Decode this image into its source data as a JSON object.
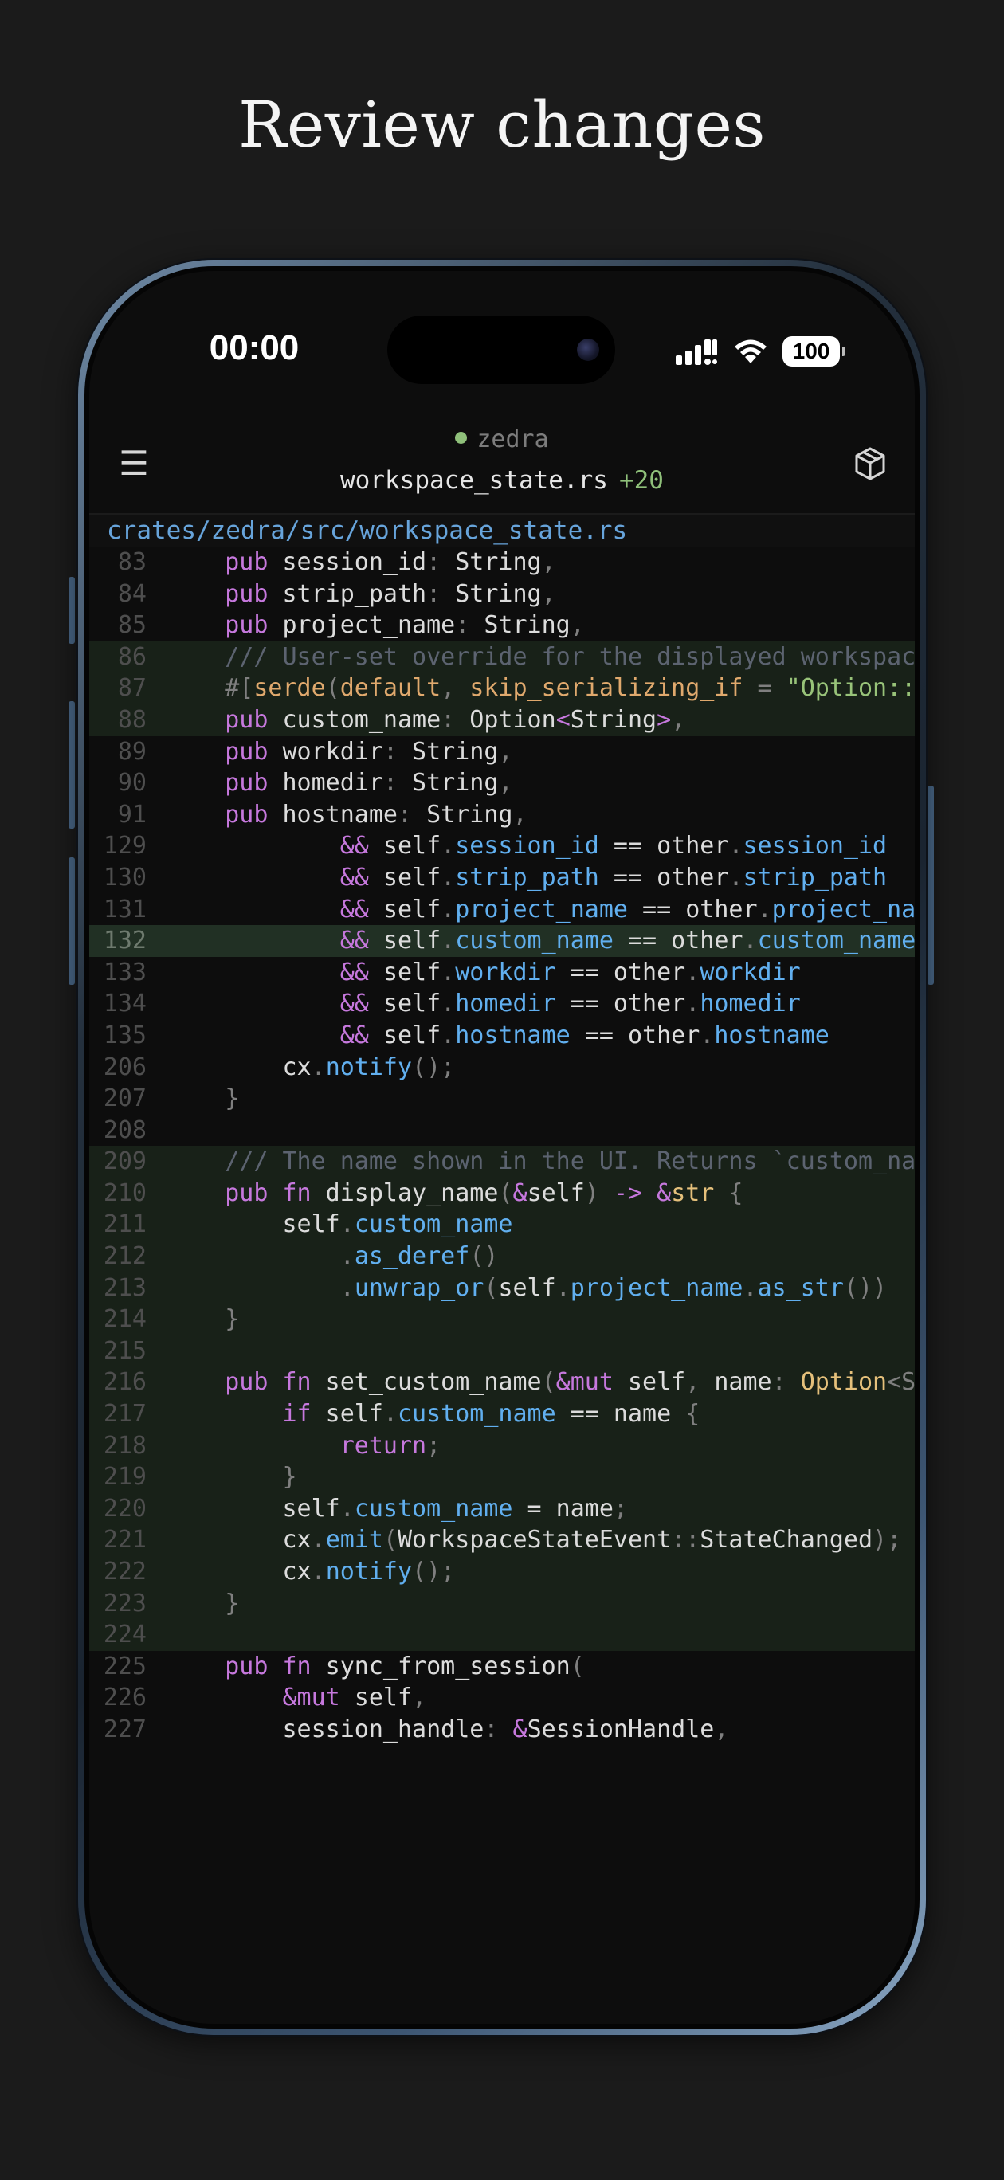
{
  "headline": "Review changes",
  "status_bar": {
    "time": "00:00",
    "battery": "100"
  },
  "nav": {
    "workspace": "zedra",
    "file": "workspace_state.rs",
    "added": "+20"
  },
  "file_path": "crates/zedra/src/workspace_state.rs",
  "colors": {
    "background": "#1b1b1b",
    "screen": "#0d0d0d",
    "added_row": "#182118",
    "keyword": "#c678dd",
    "type": "#e5c07b",
    "string": "#98c379",
    "field": "#61afef",
    "comment": "#5c6370",
    "path": "#67a4db"
  },
  "code_lines": [
    {
      "n": "83",
      "s": "added0",
      "tokens": [
        [
          "    ",
          ""
        ],
        [
          "pub",
          "k"
        ],
        [
          " session_id",
          ""
        ],
        [
          ":",
          "p"
        ],
        [
          " String",
          ""
        ],
        [
          ",",
          "p"
        ]
      ]
    },
    {
      "n": "84",
      "s": "",
      "tokens": [
        [
          "    ",
          ""
        ],
        [
          "pub",
          "k"
        ],
        [
          " strip_path",
          ""
        ],
        [
          ":",
          "p"
        ],
        [
          " String",
          ""
        ],
        [
          ",",
          "p"
        ]
      ]
    },
    {
      "n": "85",
      "s": "",
      "tokens": [
        [
          "    ",
          ""
        ],
        [
          "pub",
          "k"
        ],
        [
          " project_name",
          ""
        ],
        [
          ":",
          "p"
        ],
        [
          " String",
          ""
        ],
        [
          ",",
          "p"
        ]
      ]
    },
    {
      "n": "86",
      "s": "added",
      "tokens": [
        [
          "    ",
          ""
        ],
        [
          "/// User-set override for the displayed workspace name",
          "c"
        ]
      ]
    },
    {
      "n": "87",
      "s": "added",
      "tokens": [
        [
          "    ",
          ""
        ],
        [
          "#[",
          "p"
        ],
        [
          "serde",
          "a"
        ],
        [
          "(",
          "p"
        ],
        [
          "default",
          "a"
        ],
        [
          ", ",
          "p"
        ],
        [
          "skip_serializing_if",
          "a"
        ],
        [
          " = ",
          "p"
        ],
        [
          "\"Option::is_none\"",
          "s"
        ],
        [
          ")]",
          "p"
        ]
      ]
    },
    {
      "n": "88",
      "s": "added",
      "tokens": [
        [
          "    ",
          ""
        ],
        [
          "pub",
          "k"
        ],
        [
          " custom_name",
          ""
        ],
        [
          ":",
          "p"
        ],
        [
          " Option",
          ""
        ],
        [
          "<",
          "k"
        ],
        [
          "String",
          ""
        ],
        [
          ">",
          "k"
        ],
        [
          ",",
          "p"
        ]
      ]
    },
    {
      "n": "89",
      "s": "",
      "tokens": [
        [
          "    ",
          ""
        ],
        [
          "pub",
          "k"
        ],
        [
          " workdir",
          ""
        ],
        [
          ":",
          "p"
        ],
        [
          " String",
          ""
        ],
        [
          ",",
          "p"
        ]
      ]
    },
    {
      "n": "90",
      "s": "",
      "tokens": [
        [
          "    ",
          ""
        ],
        [
          "pub",
          "k"
        ],
        [
          " homedir",
          ""
        ],
        [
          ":",
          "p"
        ],
        [
          " String",
          ""
        ],
        [
          ",",
          "p"
        ]
      ]
    },
    {
      "n": "91",
      "s": "",
      "tokens": [
        [
          "    ",
          ""
        ],
        [
          "pub",
          "k"
        ],
        [
          " hostname",
          ""
        ],
        [
          ":",
          "p"
        ],
        [
          " String",
          ""
        ],
        [
          ",",
          "p"
        ]
      ]
    },
    {
      "n": "129",
      "s": "",
      "tokens": [
        [
          "            ",
          ""
        ],
        [
          "&&",
          "k"
        ],
        [
          " self",
          ""
        ],
        [
          ".",
          "p"
        ],
        [
          "session_id",
          "f"
        ],
        [
          " ==",
          ""
        ],
        [
          " other",
          ""
        ],
        [
          ".",
          "p"
        ],
        [
          "session_id",
          "f"
        ]
      ]
    },
    {
      "n": "130",
      "s": "",
      "tokens": [
        [
          "            ",
          ""
        ],
        [
          "&&",
          "k"
        ],
        [
          " self",
          ""
        ],
        [
          ".",
          "p"
        ],
        [
          "strip_path",
          "f"
        ],
        [
          " ==",
          ""
        ],
        [
          " other",
          ""
        ],
        [
          ".",
          "p"
        ],
        [
          "strip_path",
          "f"
        ]
      ]
    },
    {
      "n": "131",
      "s": "",
      "tokens": [
        [
          "            ",
          ""
        ],
        [
          "&&",
          "k"
        ],
        [
          " self",
          ""
        ],
        [
          ".",
          "p"
        ],
        [
          "project_name",
          "f"
        ],
        [
          " ==",
          ""
        ],
        [
          " other",
          ""
        ],
        [
          ".",
          "p"
        ],
        [
          "project_name",
          "f"
        ]
      ]
    },
    {
      "n": "132",
      "s": "hl",
      "tokens": [
        [
          "            ",
          ""
        ],
        [
          "&&",
          "k"
        ],
        [
          " self",
          ""
        ],
        [
          ".",
          "p"
        ],
        [
          "custom_name",
          "f"
        ],
        [
          " ==",
          ""
        ],
        [
          " other",
          ""
        ],
        [
          ".",
          "p"
        ],
        [
          "custom_name",
          "f"
        ]
      ]
    },
    {
      "n": "133",
      "s": "",
      "tokens": [
        [
          "            ",
          ""
        ],
        [
          "&&",
          "k"
        ],
        [
          " self",
          ""
        ],
        [
          ".",
          "p"
        ],
        [
          "workdir",
          "f"
        ],
        [
          " ==",
          ""
        ],
        [
          " other",
          ""
        ],
        [
          ".",
          "p"
        ],
        [
          "workdir",
          "f"
        ]
      ]
    },
    {
      "n": "134",
      "s": "",
      "tokens": [
        [
          "            ",
          ""
        ],
        [
          "&&",
          "k"
        ],
        [
          " self",
          ""
        ],
        [
          ".",
          "p"
        ],
        [
          "homedir",
          "f"
        ],
        [
          " ==",
          ""
        ],
        [
          " other",
          ""
        ],
        [
          ".",
          "p"
        ],
        [
          "homedir",
          "f"
        ]
      ]
    },
    {
      "n": "135",
      "s": "",
      "tokens": [
        [
          "            ",
          ""
        ],
        [
          "&&",
          "k"
        ],
        [
          " self",
          ""
        ],
        [
          ".",
          "p"
        ],
        [
          "hostname",
          "f"
        ],
        [
          " ==",
          ""
        ],
        [
          " other",
          ""
        ],
        [
          ".",
          "p"
        ],
        [
          "hostname",
          "f"
        ]
      ]
    },
    {
      "n": "206",
      "s": "",
      "tokens": [
        [
          "        ",
          ""
        ],
        [
          "cx",
          ""
        ],
        [
          ".",
          "p"
        ],
        [
          "notify",
          "f"
        ],
        [
          "();",
          "p"
        ]
      ]
    },
    {
      "n": "207",
      "s": "",
      "tokens": [
        [
          "    ",
          ""
        ],
        [
          "}",
          "p"
        ]
      ]
    },
    {
      "n": "208",
      "s": "",
      "tokens": []
    },
    {
      "n": "209",
      "s": "added",
      "tokens": [
        [
          "    ",
          ""
        ],
        [
          "/// The name shown in the UI. Returns `custom_name` if set",
          "c"
        ]
      ]
    },
    {
      "n": "210",
      "s": "added",
      "tokens": [
        [
          "    ",
          ""
        ],
        [
          "pub",
          "k"
        ],
        [
          " fn",
          "k"
        ],
        [
          " display_name",
          ""
        ],
        [
          "(",
          "p"
        ],
        [
          "&",
          "k"
        ],
        [
          "self",
          ""
        ],
        [
          ")",
          "p"
        ],
        [
          " ->",
          "k"
        ],
        [
          " &",
          "k"
        ],
        [
          "str",
          "t"
        ],
        [
          " {",
          "p"
        ]
      ]
    },
    {
      "n": "211",
      "s": "added",
      "tokens": [
        [
          "        ",
          ""
        ],
        [
          "self",
          ""
        ],
        [
          ".",
          "p"
        ],
        [
          "custom_name",
          "f"
        ]
      ]
    },
    {
      "n": "212",
      "s": "added",
      "tokens": [
        [
          "            ",
          ""
        ],
        [
          ".",
          "p"
        ],
        [
          "as_deref",
          "f"
        ],
        [
          "()",
          "p"
        ]
      ]
    },
    {
      "n": "213",
      "s": "added",
      "tokens": [
        [
          "            ",
          ""
        ],
        [
          ".",
          "p"
        ],
        [
          "unwrap_or",
          "f"
        ],
        [
          "(",
          "p"
        ],
        [
          "self",
          ""
        ],
        [
          ".",
          "p"
        ],
        [
          "project_name",
          "f"
        ],
        [
          ".",
          "p"
        ],
        [
          "as_str",
          "f"
        ],
        [
          "())",
          "p"
        ]
      ]
    },
    {
      "n": "214",
      "s": "added",
      "tokens": [
        [
          "    ",
          ""
        ],
        [
          "}",
          "p"
        ]
      ]
    },
    {
      "n": "215",
      "s": "added",
      "tokens": []
    },
    {
      "n": "216",
      "s": "added",
      "tokens": [
        [
          "    ",
          ""
        ],
        [
          "pub",
          "k"
        ],
        [
          " fn",
          "k"
        ],
        [
          " set_custom_name",
          ""
        ],
        [
          "(",
          "p"
        ],
        [
          "&mut",
          "k"
        ],
        [
          " self",
          ""
        ],
        [
          ",",
          "p"
        ],
        [
          " name",
          ""
        ],
        [
          ":",
          "p"
        ],
        [
          " Option",
          "t"
        ],
        [
          "<String>)",
          "p"
        ]
      ]
    },
    {
      "n": "217",
      "s": "added",
      "tokens": [
        [
          "        ",
          ""
        ],
        [
          "if",
          "k"
        ],
        [
          " self",
          ""
        ],
        [
          ".",
          "p"
        ],
        [
          "custom_name",
          "f"
        ],
        [
          " ==",
          ""
        ],
        [
          " name",
          ""
        ],
        [
          " {",
          "p"
        ]
      ]
    },
    {
      "n": "218",
      "s": "added",
      "tokens": [
        [
          "            ",
          ""
        ],
        [
          "return",
          "k"
        ],
        [
          ";",
          "p"
        ]
      ]
    },
    {
      "n": "219",
      "s": "added",
      "tokens": [
        [
          "        ",
          ""
        ],
        [
          "}",
          "p"
        ]
      ]
    },
    {
      "n": "220",
      "s": "added",
      "tokens": [
        [
          "        ",
          ""
        ],
        [
          "self",
          ""
        ],
        [
          ".",
          "p"
        ],
        [
          "custom_name",
          "f"
        ],
        [
          " =",
          ""
        ],
        [
          " name",
          ""
        ],
        [
          ";",
          "p"
        ]
      ]
    },
    {
      "n": "221",
      "s": "added",
      "tokens": [
        [
          "        ",
          ""
        ],
        [
          "cx",
          ""
        ],
        [
          ".",
          "p"
        ],
        [
          "emit",
          "f"
        ],
        [
          "(",
          "p"
        ],
        [
          "WorkspaceStateEvent",
          ""
        ],
        [
          "::",
          "p"
        ],
        [
          "StateChanged",
          ""
        ],
        [
          ");",
          "p"
        ]
      ]
    },
    {
      "n": "222",
      "s": "added",
      "tokens": [
        [
          "        ",
          ""
        ],
        [
          "cx",
          ""
        ],
        [
          ".",
          "p"
        ],
        [
          "notify",
          "f"
        ],
        [
          "();",
          "p"
        ]
      ]
    },
    {
      "n": "223",
      "s": "added",
      "tokens": [
        [
          "    ",
          ""
        ],
        [
          "}",
          "p"
        ]
      ]
    },
    {
      "n": "224",
      "s": "added",
      "tokens": []
    },
    {
      "n": "225",
      "s": "",
      "tokens": [
        [
          "    ",
          ""
        ],
        [
          "pub",
          "k"
        ],
        [
          " fn",
          "k"
        ],
        [
          " sync_from_session",
          ""
        ],
        [
          "(",
          "p"
        ]
      ]
    },
    {
      "n": "226",
      "s": "",
      "tokens": [
        [
          "        ",
          ""
        ],
        [
          "&mut",
          "k"
        ],
        [
          " self",
          ""
        ],
        [
          ",",
          "p"
        ]
      ]
    },
    {
      "n": "227",
      "s": "",
      "tokens": [
        [
          "        ",
          ""
        ],
        [
          "session_handle",
          ""
        ],
        [
          ":",
          "p"
        ],
        [
          " &",
          "k"
        ],
        [
          "SessionHandle",
          ""
        ],
        [
          ",",
          "p"
        ]
      ]
    }
  ]
}
